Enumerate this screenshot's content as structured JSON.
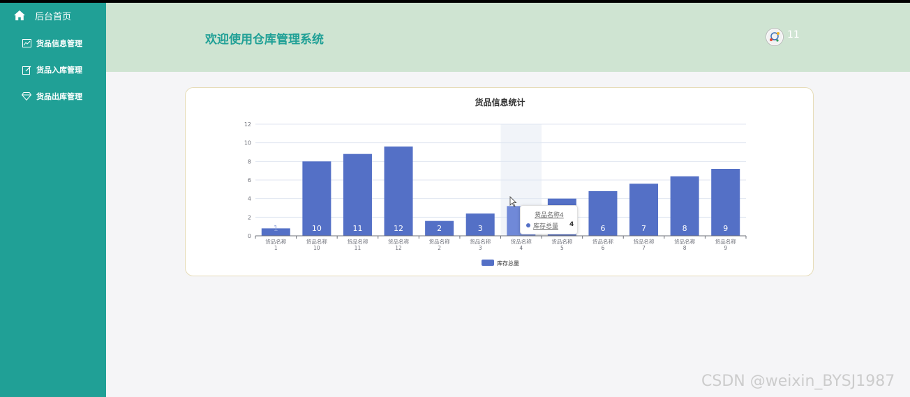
{
  "sidebar": {
    "home_label": "后台首页",
    "items": [
      {
        "label": "货品信息管理",
        "icon": "chart-line-icon"
      },
      {
        "label": "货品入库管理",
        "icon": "edit-icon"
      },
      {
        "label": "货品出库管理",
        "icon": "diamond-icon"
      }
    ]
  },
  "header": {
    "title": "欢迎使用仓库管理系统",
    "username": "11"
  },
  "tooltip": {
    "category": "货品名称4",
    "series": "库存总量",
    "value": "4"
  },
  "watermark": "CSDN @weixin_BYSJ1987",
  "colors": {
    "sidebar": "#20a096",
    "header": "#cfe4d2",
    "bar": "#5470c6",
    "bar_highlight": "#7089d8"
  },
  "chart_data": {
    "type": "bar",
    "title": "货品信息统计",
    "categories": [
      [
        "货品名称",
        "1"
      ],
      [
        "货品名称",
        "10"
      ],
      [
        "货品名称",
        "11"
      ],
      [
        "货品名称",
        "12"
      ],
      [
        "货品名称",
        "2"
      ],
      [
        "货品名称",
        "3"
      ],
      [
        "货品名称",
        "4"
      ],
      [
        "货品名称",
        "5"
      ],
      [
        "货品名称",
        "6"
      ],
      [
        "货品名称",
        "7"
      ],
      [
        "货品名称",
        "8"
      ],
      [
        "货品名称",
        "9"
      ]
    ],
    "series": [
      {
        "name": "库存总量",
        "values": [
          0.8,
          8.0,
          8.8,
          9.6,
          1.6,
          2.4,
          3.2,
          4.0,
          4.8,
          5.6,
          6.4,
          7.2
        ],
        "labels": [
          "1",
          "10",
          "11",
          "12",
          "2",
          "3",
          "",
          "",
          "6",
          "7",
          "8",
          "9"
        ]
      }
    ],
    "ylim": [
      0,
      12
    ],
    "yticks": [
      0,
      2,
      4,
      6,
      8,
      10,
      12
    ],
    "grid": true,
    "legend": "bottom-center",
    "highlighted_category_index": 6
  }
}
